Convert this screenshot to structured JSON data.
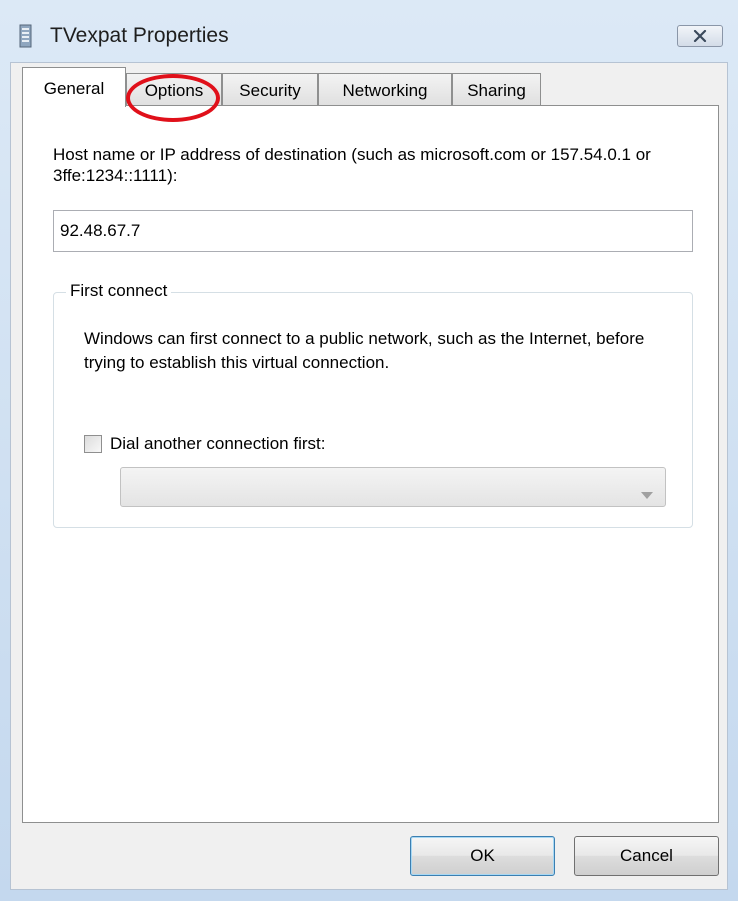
{
  "window": {
    "title": "TVexpat Properties",
    "close_icon": "close-icon"
  },
  "tabs": [
    {
      "label": "General",
      "active": true
    },
    {
      "label": "Options",
      "active": false
    },
    {
      "label": "Security",
      "active": false
    },
    {
      "label": "Networking",
      "active": false
    },
    {
      "label": "Sharing",
      "active": false
    }
  ],
  "general": {
    "host_label": "Host name or IP address of destination (such as microsoft.com or 157.54.0.1 or 3ffe:1234::1111):",
    "host_value": "92.48.67.7",
    "first_connect": {
      "title": "First connect",
      "description": "Windows can first connect to a public network, such as the Internet, before trying to establish this virtual connection.",
      "checkbox_label": "Dial another connection first:",
      "checkbox_checked": false,
      "combo_value": ""
    }
  },
  "buttons": {
    "ok": "OK",
    "cancel": "Cancel"
  },
  "colors": {
    "annotation": "#e0101a"
  }
}
